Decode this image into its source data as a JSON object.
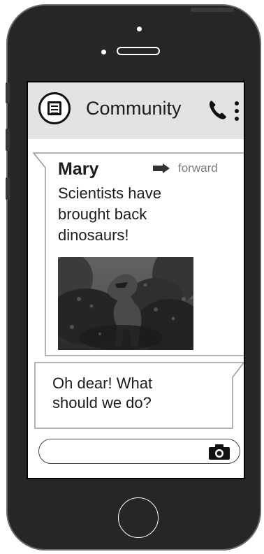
{
  "header": {
    "title": "Community",
    "app_icon": "newspaper-icon",
    "call_icon": "phone-icon",
    "menu_icon": "more-vertical-icon"
  },
  "messages": [
    {
      "sender": "Mary",
      "forward_label": "forward",
      "forward_icon": "arrow-right-icon",
      "text_lines": [
        "Scientists have",
        "brought back",
        "dinosaurs!"
      ],
      "attachment": "dinosaur-photo"
    },
    {
      "text_lines": [
        "Oh dear! What",
        "should we do?"
      ]
    }
  ],
  "composer": {
    "value": "",
    "camera_icon": "camera-icon"
  },
  "colors": {
    "phone_body": "#262625",
    "header_bg": "#e3e3e3",
    "bubble_border": "#9a9a9a",
    "forward_text": "#7a7a7a"
  }
}
